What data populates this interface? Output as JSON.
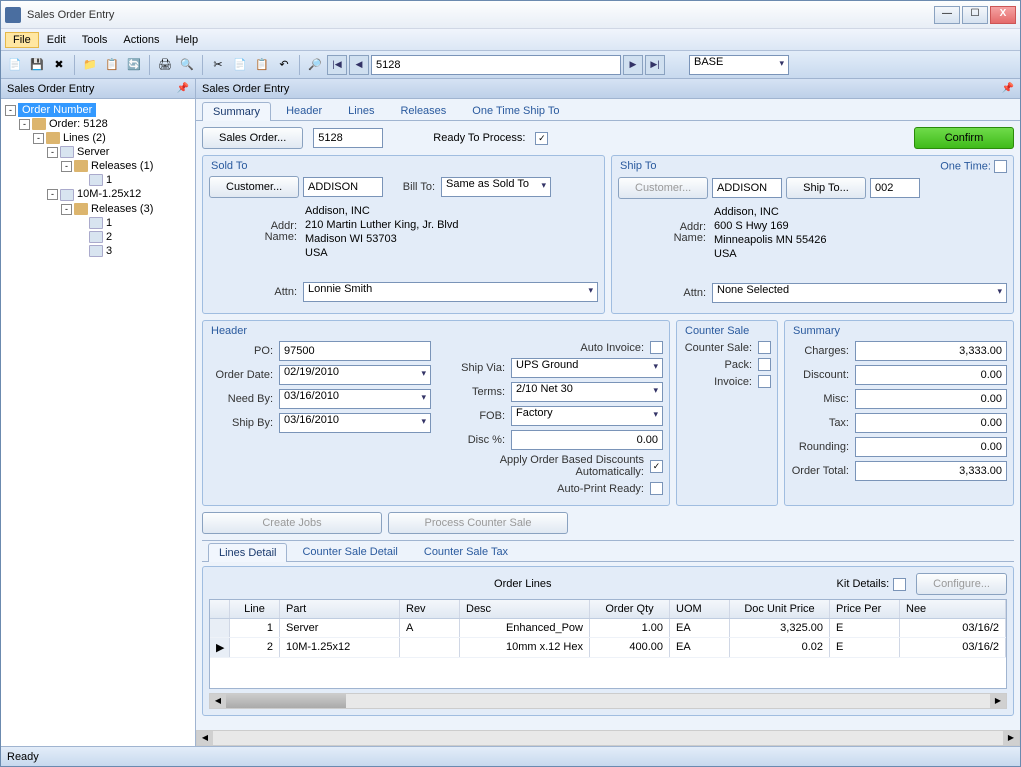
{
  "window": {
    "title": "Sales Order Entry"
  },
  "menu": {
    "file": "File",
    "edit": "Edit",
    "tools": "Tools",
    "actions": "Actions",
    "help": "Help"
  },
  "toolbar": {
    "order_no": "5128",
    "warehouse": "BASE"
  },
  "leftPanel": {
    "title": "Sales Order Entry"
  },
  "tree": {
    "root": "Order Number",
    "order": "Order: 5128",
    "lines": "Lines (2)",
    "server": "Server",
    "serverRel": "Releases (1)",
    "r1": "1",
    "part2": "10M-1.25x12",
    "part2Rel": "Releases (3)",
    "r2a": "1",
    "r2b": "2",
    "r2c": "3"
  },
  "rightPanel": {
    "title": "Sales Order Entry"
  },
  "tabs": {
    "summary": "Summary",
    "header": "Header",
    "lines": "Lines",
    "releases": "Releases",
    "oneTime": "One Time Ship To"
  },
  "top": {
    "salesOrderBtn": "Sales Order...",
    "orderNo": "5128",
    "readyLabel": "Ready To Process:",
    "confirmBtn": "Confirm"
  },
  "soldTo": {
    "title": "Sold To",
    "customerBtn": "Customer...",
    "customer": "ADDISON",
    "billToLabel": "Bill To:",
    "billTo": "Same as Sold To",
    "nameLabel": "Name:",
    "addrLabel": "Addr:",
    "name": "Addison, INC",
    "addr1": "210 Martin Luther King, Jr. Blvd",
    "addr2": "Madison WI 53703",
    "addr3": "USA",
    "attnLabel": "Attn:",
    "attn": "Lonnie Smith"
  },
  "shipTo": {
    "title": "Ship To",
    "oneTimeLabel": "One Time:",
    "customerBtn": "Customer...",
    "customer": "ADDISON",
    "shipToBtn": "Ship To...",
    "shipToId": "002",
    "nameLabel": "Name:",
    "addrLabel": "Addr:",
    "name": "Addison, INC",
    "addr1": "600 S Hwy 169",
    "addr2": "Minneapolis MN 55426",
    "addr3": "USA",
    "attnLabel": "Attn:",
    "attn": "None Selected"
  },
  "header": {
    "title": "Header",
    "poLabel": "PO:",
    "po": "97500",
    "orderDateLabel": "Order Date:",
    "orderDate": "02/19/2010",
    "needByLabel": "Need By:",
    "needBy": "03/16/2010",
    "shipByLabel": "Ship By:",
    "shipBy": "03/16/2010",
    "autoInvLabel": "Auto Invoice:",
    "shipViaLabel": "Ship Via:",
    "shipVia": "UPS Ground",
    "termsLabel": "Terms:",
    "terms": "2/10 Net 30",
    "fobLabel": "FOB:",
    "fob": "Factory",
    "discLabel": "Disc %:",
    "disc": "0.00",
    "applyDiscLabel": "Apply Order Based Discounts Automatically:",
    "autoPrintLabel": "Auto-Print Ready:"
  },
  "counterSale": {
    "title": "Counter Sale",
    "csLabel": "Counter Sale:",
    "packLabel": "Pack:",
    "invLabel": "Invoice:"
  },
  "summary": {
    "title": "Summary",
    "chargesLabel": "Charges:",
    "charges": "3,333.00",
    "discountLabel": "Discount:",
    "discount": "0.00",
    "miscLabel": "Misc:",
    "misc": "0.00",
    "taxLabel": "Tax:",
    "tax": "0.00",
    "roundingLabel": "Rounding:",
    "rounding": "0.00",
    "totalLabel": "Order Total:",
    "total": "3,333.00"
  },
  "buttons": {
    "createJobs": "Create Jobs",
    "processCS": "Process Counter Sale"
  },
  "linesTabs": {
    "detail": "Lines Detail",
    "csDetail": "Counter Sale Detail",
    "csTax": "Counter Sale Tax"
  },
  "orderLines": {
    "title": "Order Lines",
    "kitLabel": "Kit Details:",
    "configBtn": "Configure...",
    "cols": {
      "line": "Line",
      "part": "Part",
      "rev": "Rev",
      "desc": "Desc",
      "qty": "Order Qty",
      "uom": "UOM",
      "price": "Doc Unit Price",
      "priceper": "Price Per",
      "need": "Nee"
    },
    "rows": [
      {
        "line": "1",
        "part": "Server",
        "rev": "A",
        "desc": "Enhanced_Pow",
        "qty": "1.00",
        "uom": "EA",
        "price": "3,325.00",
        "priceper": "E",
        "need": "03/16/2"
      },
      {
        "line": "2",
        "part": "10M-1.25x12",
        "rev": "",
        "desc": "10mm x.12 Hex",
        "qty": "400.00",
        "uom": "EA",
        "price": "0.02",
        "priceper": "E",
        "need": "03/16/2"
      }
    ]
  },
  "status": {
    "ready": "Ready"
  }
}
